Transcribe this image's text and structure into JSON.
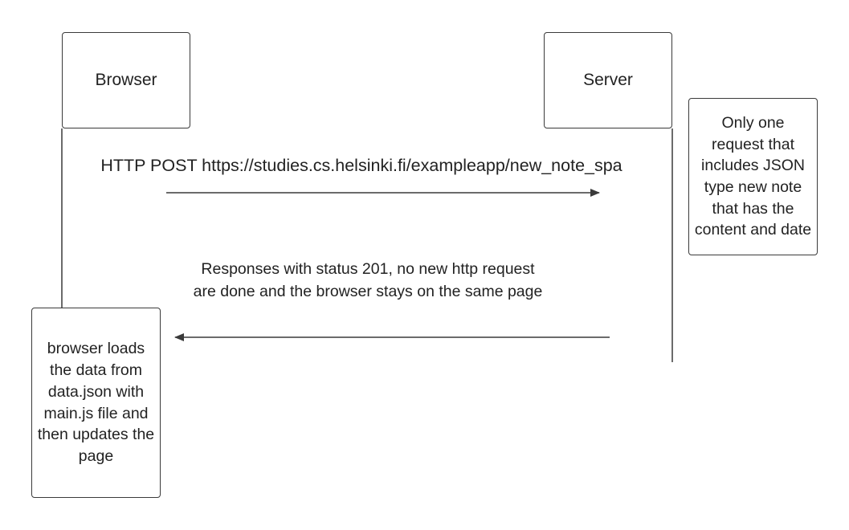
{
  "participants": {
    "browser": {
      "label": "Browser"
    },
    "server": {
      "label": "Server"
    }
  },
  "messages": {
    "post": {
      "label": "HTTP POST https://studies.cs.helsinki.fi/exampleapp/new_note_spa"
    },
    "response": {
      "label": "Responses with status 201, no new http request are done and the browser stays on the same page"
    }
  },
  "notes": {
    "server_note": {
      "text": "Only one request that includes JSON type new note that has the content and date"
    },
    "browser_note": {
      "text": "browser loads the data from data.json with main.js file and then updates the page"
    }
  },
  "colors": {
    "line": "#3a3a3a",
    "text": "#222222",
    "background": "#ffffff"
  }
}
